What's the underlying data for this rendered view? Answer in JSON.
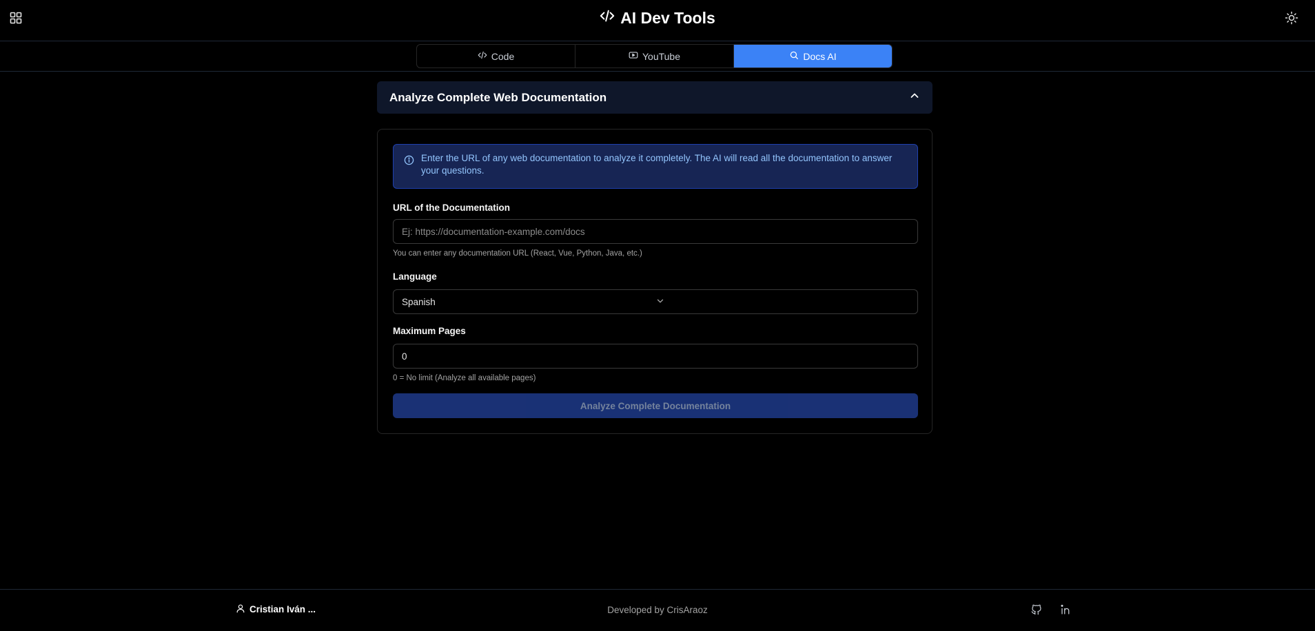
{
  "header": {
    "title": "AI Dev Tools",
    "apps_icon": "grid-icon",
    "theme_icon": "sun-icon"
  },
  "tabs": [
    {
      "label": "Code",
      "icon": "code-icon",
      "active": false
    },
    {
      "label": "YouTube",
      "icon": "youtube-icon",
      "active": false
    },
    {
      "label": "Docs AI",
      "icon": "search-icon",
      "active": true
    }
  ],
  "section": {
    "title": "Analyze Complete Web Documentation",
    "expanded": true
  },
  "form": {
    "info_text": "Enter the URL of any web documentation to analyze it completely. The AI will read all the documentation to answer your questions.",
    "url_label": "URL of the Documentation",
    "url_placeholder": "Ej: https://documentation-example.com/docs",
    "url_value": "",
    "url_hint": "You can enter any documentation URL (React, Vue, Python, Java, etc.)",
    "language_label": "Language",
    "language_value": "Spanish",
    "max_pages_label": "Maximum Pages",
    "max_pages_value": "0",
    "max_pages_hint": "0 = No limit (Analyze all available pages)",
    "submit_label": "Analyze Complete Documentation"
  },
  "footer": {
    "user_name": "Cristian Iván ...",
    "credit": "Developed by CrisAraoz",
    "github_icon": "github-icon",
    "linkedin_icon": "linkedin-icon"
  },
  "colors": {
    "background": "#000000",
    "accent": "#3b82f6",
    "info_bg": "#172554",
    "info_text": "#93c5fd",
    "section_bg": "#0f172a",
    "submit_bg": "#1e3a8a"
  }
}
